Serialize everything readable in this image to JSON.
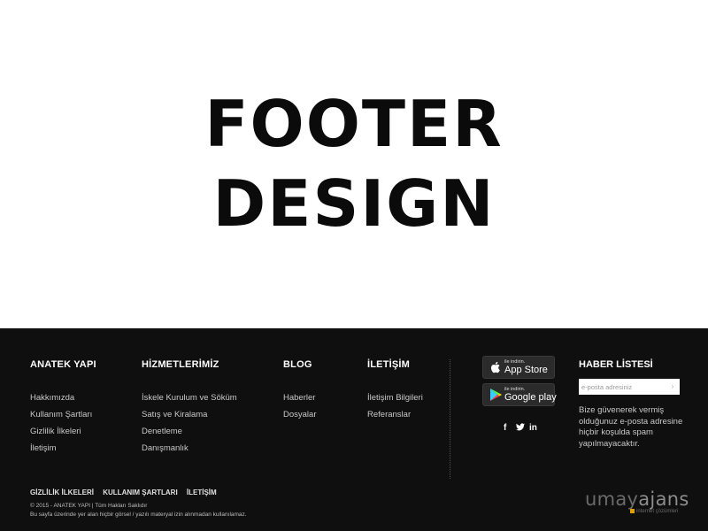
{
  "hero": {
    "title_line1": "FOOTER",
    "title_line2": "DESIGN"
  },
  "columns": [
    {
      "heading": "ANATEK YAPI",
      "items": [
        "Hakkımızda",
        "Kullanım Şartları",
        "Gizlilik İlkeleri",
        "İletişim"
      ]
    },
    {
      "heading": "HİZMETLERİMİZ",
      "items": [
        "İskele Kurulum ve Söküm",
        "Satış ve Kiralama",
        "Denetleme",
        "Danışmanlık"
      ]
    },
    {
      "heading": "BLOG",
      "items": [
        "Haberler",
        "Dosyalar"
      ]
    },
    {
      "heading": "İLETİŞİM",
      "items": [
        "İletişim Bilgileri",
        "Referanslar"
      ]
    }
  ],
  "apps": {
    "app_store": {
      "small": "ile indirin.",
      "big": "App Store"
    },
    "google_play": {
      "small": "ile indirin.",
      "big": "Google play"
    }
  },
  "social": {
    "facebook": "f",
    "twitter": "t",
    "linkedin": "in"
  },
  "newsletter": {
    "heading": "HABER LİSTESİ",
    "placeholder": "e-posta adresiniz",
    "text": "Bize güvenerek vermiş olduğunuz e-posta adresine hiçbir koşulda spam yapılmayacaktır."
  },
  "bottom": {
    "links": [
      "GİZLİLİK İLKELERİ",
      "KULLANIM ŞARTLARI",
      "İLETİŞİM"
    ],
    "copyright": "© 2015 - ANATEK YAPI | Tüm Hakları Saklıdır",
    "notice": "Bu sayfa üzerinde yer alan hiçbir görsel / yazılı materyal izin alınmadan kullanılamaz."
  },
  "brand": {
    "part1": "umay",
    "part2": "ajans",
    "sub": "internet çözümleri"
  },
  "colors": {
    "footer_bg": "#0f0f10",
    "brand_accent": "#e0a100"
  }
}
